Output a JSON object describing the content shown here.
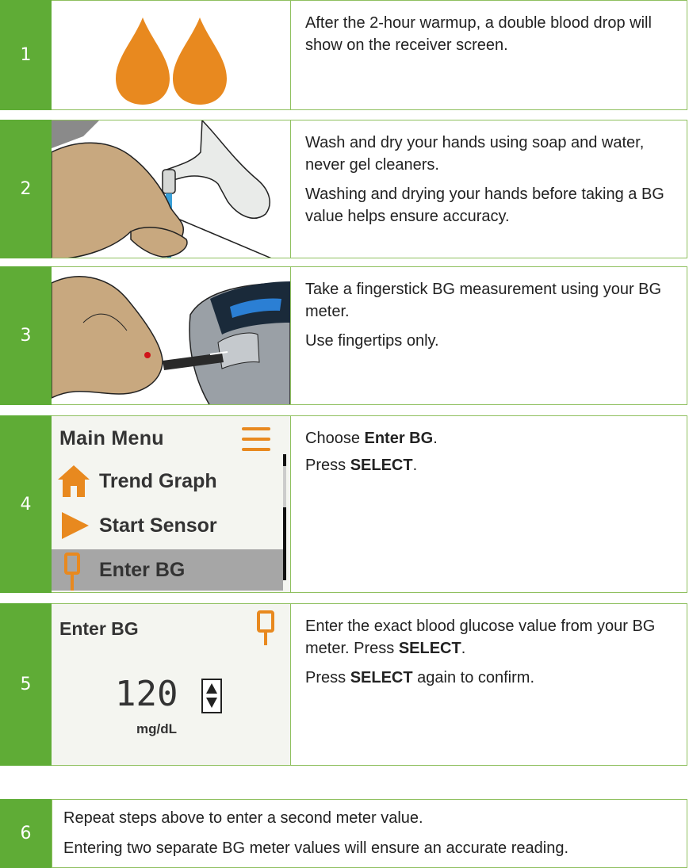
{
  "steps": [
    {
      "number": "1",
      "paragraphs": [
        "After the 2-hour warmup, a double blood drop will show on the receiver screen."
      ]
    },
    {
      "number": "2",
      "paragraphs": [
        "Wash and dry your hands using soap and water, never gel cleaners.",
        "Washing and drying your hands before taking a BG value helps ensure accuracy."
      ]
    },
    {
      "number": "3",
      "paragraphs": [
        "Take a fingerstick BG measurement using your BG meter.",
        "Use fingertips only."
      ]
    },
    {
      "number": "4",
      "p1_prefix": "Choose ",
      "p1_bold": "Enter BG",
      "p1_suffix": ".",
      "p2_prefix": "Press ",
      "p2_bold": "SELECT",
      "p2_suffix": "."
    },
    {
      "number": "5",
      "p1_prefix": "Enter the exact blood glucose value from your BG meter. Press ",
      "p1_bold": "SELECT",
      "p1_suffix": ".",
      "p2_prefix": "Press ",
      "p2_bold": "SELECT",
      "p2_suffix": " again to confirm."
    },
    {
      "number": "6",
      "paragraphs": [
        "Repeat steps above to enter a second meter value.",
        "Entering two separate BG meter values will ensure an accurate reading."
      ]
    }
  ],
  "receiver_menu": {
    "title": "Main Menu",
    "items": [
      "Trend Graph",
      "Start Sensor",
      "Enter BG"
    ],
    "selected_item": "Enter BG"
  },
  "receiver_enter_bg": {
    "title": "Enter BG",
    "value": "120",
    "unit": "mg/dL"
  },
  "colors": {
    "step_green": "#5fac36",
    "border_green": "#8fc05f",
    "drop_orange": "#e8891f",
    "selection_gray": "#a6a6a6"
  }
}
